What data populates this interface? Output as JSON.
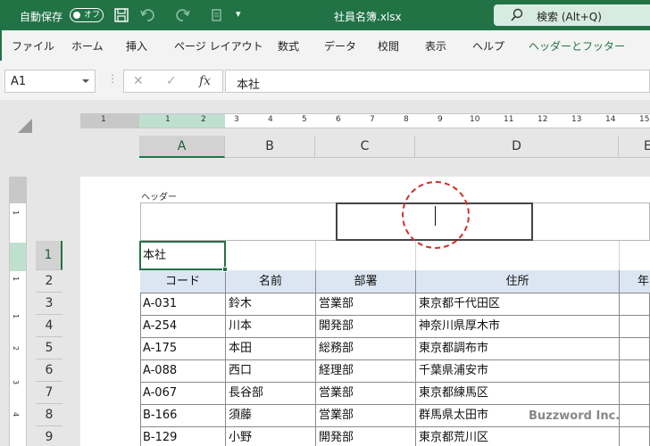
{
  "titlebar": {
    "autosave_label": "自動保存",
    "autosave_state": "オフ",
    "filename": "社員名簿.xlsx",
    "dropdown_glyph": "▾",
    "search_placeholder": "検索 (Alt+Q)",
    "bg_color": "#217346"
  },
  "ribbon": {
    "tabs": [
      "ファイル",
      "ホーム",
      "挿入",
      "ページ レイアウト",
      "数式",
      "データ",
      "校閲",
      "表示",
      "ヘルプ",
      "ヘッダーとフッター"
    ],
    "active_tab": "ヘッダーとフッター"
  },
  "formula_bar": {
    "name_box": "A1",
    "fx_label": "fx",
    "cancel_glyph": "✕",
    "enter_glyph": "✓",
    "dots": "⋮",
    "content": "本社"
  },
  "ruler": {
    "h_numbers": [
      "1",
      "1",
      "2",
      "3",
      "4",
      "5",
      "6",
      "7",
      "8",
      "9",
      "10",
      "11",
      "12",
      "13",
      "14",
      "15"
    ],
    "v_numbers": [
      "1",
      "1",
      "1",
      "2",
      "3",
      "4",
      "5",
      "6"
    ]
  },
  "columns": [
    "A",
    "B",
    "C",
    "D",
    "E"
  ],
  "selected_column": "A",
  "rows": [
    "1",
    "2",
    "3",
    "4",
    "5",
    "6",
    "7",
    "8",
    "9"
  ],
  "selected_row": "1",
  "header_area": {
    "label": "ヘッダー"
  },
  "sheet": {
    "a1": "本社",
    "table_headers": [
      "コード",
      "名前",
      "部署",
      "住所",
      "年"
    ],
    "table_rows": [
      [
        "A-031",
        "鈴木",
        "営業部",
        "東京都千代田区"
      ],
      [
        "A-254",
        "川本",
        "開発部",
        "神奈川県厚木市"
      ],
      [
        "A-175",
        "本田",
        "総務部",
        "東京都調布市"
      ],
      [
        "A-088",
        "西口",
        "経理部",
        "千葉県浦安市"
      ],
      [
        "A-067",
        "長谷部",
        "営業部",
        "東京都練馬区"
      ],
      [
        "B-166",
        "須藤",
        "営業部",
        "群馬県太田市"
      ],
      [
        "B-129",
        "小野",
        "開発部",
        "東京都荒川区"
      ]
    ],
    "header_fill": "#dce6f2"
  },
  "watermark": "Buzzword Inc."
}
